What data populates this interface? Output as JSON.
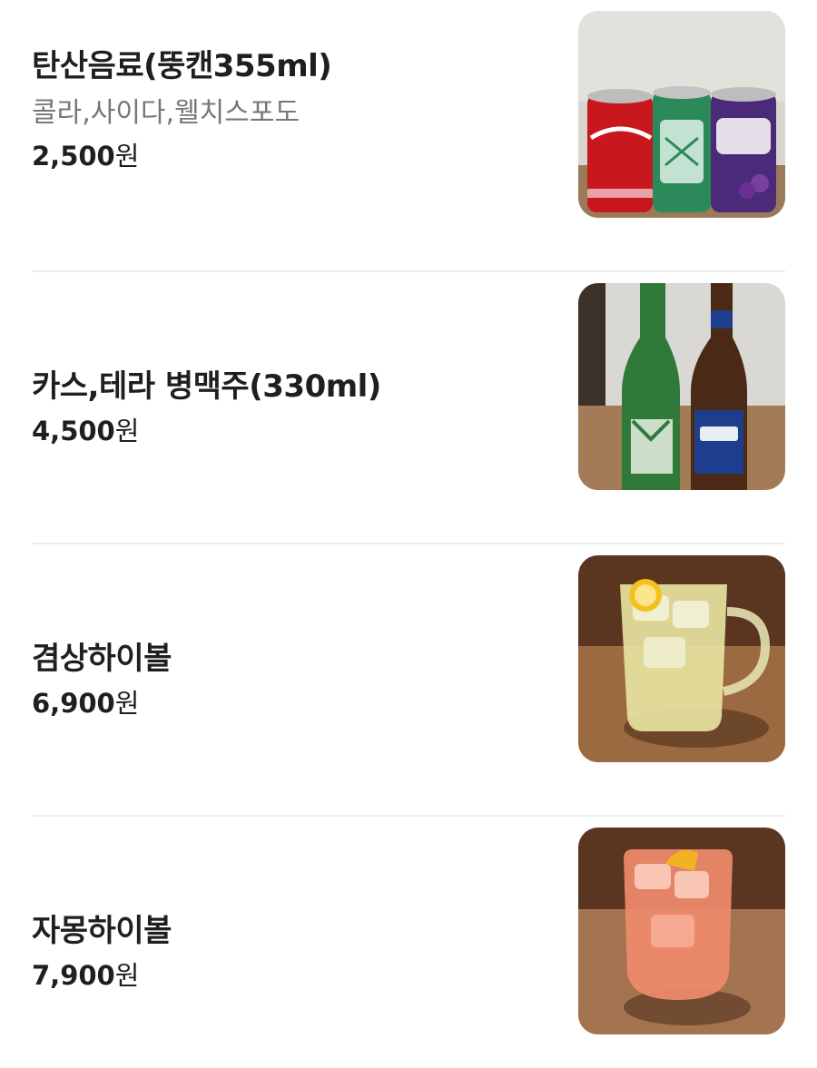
{
  "menu": {
    "items": [
      {
        "name": "탄산음료(뚱캔355ml)",
        "description": "콜라,사이다,웰치스포도",
        "price": "2,500",
        "currency": "원",
        "image_alt": "cola-sprite-welchs-cans"
      },
      {
        "name": "카스,테라 병맥주(330ml)",
        "price": "4,500",
        "currency": "원",
        "image_alt": "terra-cass-beer-bottles"
      },
      {
        "name": "겸상하이볼",
        "price": "6,900",
        "currency": "원",
        "image_alt": "highball-mug"
      },
      {
        "name": "자몽하이볼",
        "price": "7,900",
        "currency": "원",
        "image_alt": "grapefruit-highball-glass"
      }
    ]
  },
  "colors": {
    "text": "#1f1f1f",
    "muted": "#777777",
    "divider": "#eeeeee"
  }
}
